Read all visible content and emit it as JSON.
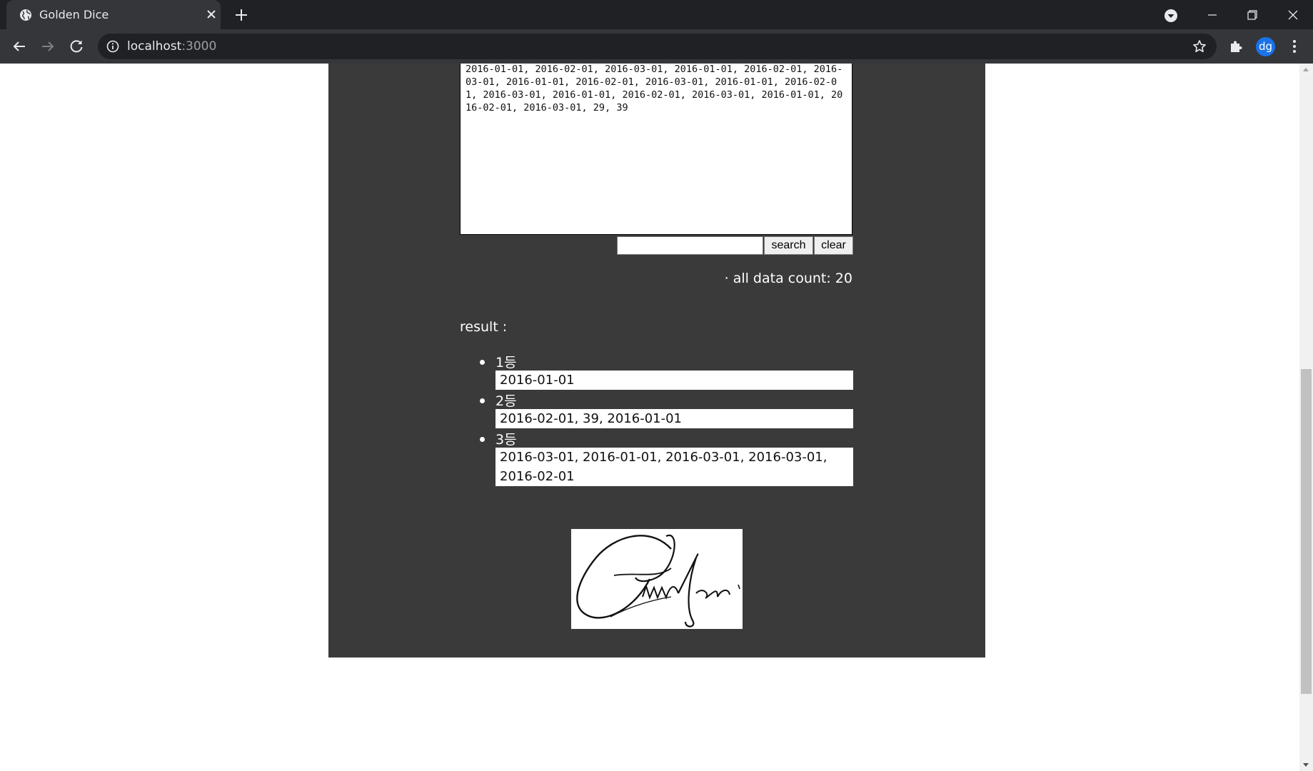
{
  "browser": {
    "tab_title": "Golden Dice",
    "url_host": "localhost",
    "url_port": ":3000",
    "profile_initials": "dg"
  },
  "page": {
    "data_text": "2016-01-01, 2016-02-01, 2016-03-01, 2016-01-01, 2016-02-01, 2016-03-01, 2016-01-01, 2016-02-01, 2016-03-01, 2016-01-01, 2016-02-01, 2016-03-01, 2016-01-01, 2016-02-01, 2016-03-01, 2016-01-01, 2016-02-01, 2016-03-01, 29, 39",
    "search_value": "",
    "search_label": "search",
    "clear_label": "clear",
    "count_text": "· all data count: 20",
    "result_label": "result :",
    "ranks": [
      {
        "title": "1등",
        "value": "2016-01-01"
      },
      {
        "title": "2등",
        "value": "2016-02-01, 39, 2016-01-01"
      },
      {
        "title": "3등",
        "value": "2016-03-01, 2016-01-01, 2016-03-01, 2016-03-01, 2016-02-01"
      }
    ]
  },
  "colors": {
    "panel_bg": "#3a3a3a",
    "chrome_dark": "#202124",
    "chrome_toolbar": "#35363a",
    "profile_blue": "#1a73e8"
  },
  "icons": [
    "globe-icon",
    "close-icon",
    "plus-icon",
    "tab-search-icon",
    "minimize-icon",
    "restore-icon",
    "window-close-icon",
    "back-icon",
    "forward-icon",
    "reload-icon",
    "info-icon",
    "star-icon",
    "extensions-icon",
    "menu-icon"
  ]
}
